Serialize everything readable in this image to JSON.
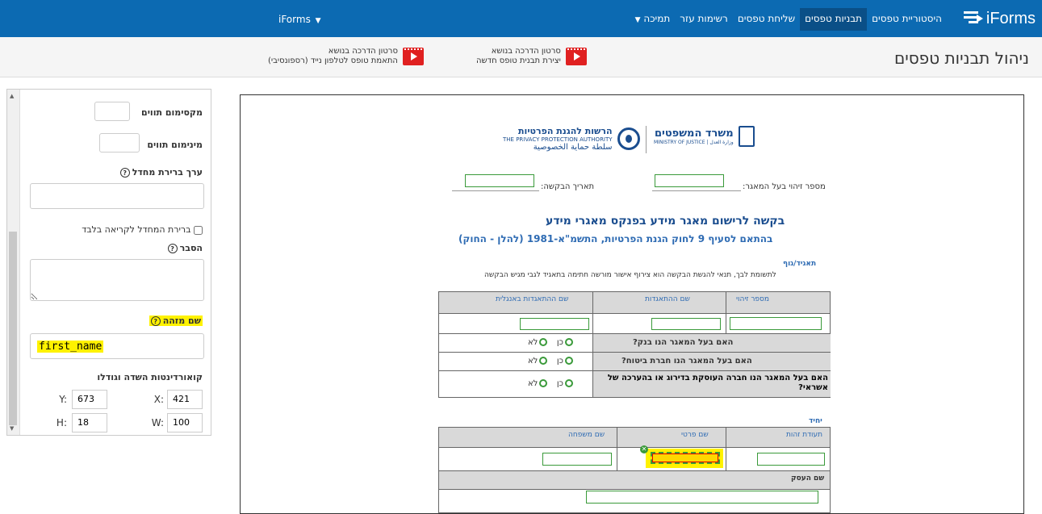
{
  "topbar": {
    "brand": "iForms",
    "nav": [
      "היסטוריית טפסים",
      "תבניות טפסים",
      "שליחת טפסים",
      "רשימות עזר",
      "תמיכה"
    ],
    "active_index": 1,
    "user_menu": "iForms"
  },
  "subheader": {
    "title": "ניהול תבניות טפסים",
    "tutorial1": {
      "line1": "סרטון הדרכה בנושא",
      "line2": "יצירת תבנית טופס חדשה"
    },
    "tutorial2": {
      "line1": "סרטון הדרכה בנושא",
      "line2": "התאמת טופס לטלפון נייד (רספונסיבי)"
    }
  },
  "panel": {
    "max_chars_label": "מקסימום תווים",
    "min_chars_label": "מינימום תווים",
    "default_value_label": "ערך ברירת מחדל",
    "readonly_label": "ברירת המחדל לקריאה בלבד",
    "explanation_label": "הסבר",
    "id_name_label": "שם מזהה",
    "id_name_value": "first_name",
    "coords_label": "קואורדינטות השדה וגודלו",
    "y_label": "Y:",
    "y_value": "673",
    "x_label": "X:",
    "x_value": "421",
    "h_label": "H:",
    "h_value": "18",
    "w_label": "W:",
    "w_value": "100"
  },
  "doc": {
    "ministry": {
      "he": "משרד המשפטים",
      "sub": "MINISTRY OF JUSTICE | وزارة العدل"
    },
    "ppa": {
      "he": "הרשות להגנת הפרטיות",
      "en": "THE PRIVACY PROTECTION AUTHORITY",
      "ar": "سلطة حماية الخصوصية"
    },
    "db_owner_id_label": "מספר זיהוי בעל המאגר:",
    "request_date_label": "תאריך הבקשה:",
    "title": "בקשה לרישום מאגר מידע בפנקס מאגרי מידע",
    "subtitle": "בהתאם לסעיף 9 לחוק הגנת הפרטיות, התשמ\"א-1981 (להלן - החוק)",
    "corp_heading": "תאגיד/גוף",
    "corp_note": "לתשומת לבך, תנאי להגשת הבקשה הוא צירוף אישור מורשה חתימה בתאגיד לגבי מגיש הבקשה",
    "col_id": "מספר זיהוי",
    "col_name": "שם ההתאגדות",
    "col_en_name": "שם ההתאגדות באנגלית",
    "q_bank": "האם בעל המאגר הנו בנק?",
    "q_insurance": "האם בעל המאגר הנו חברת ביטוח?",
    "q_credit": "האם בעל המאגר הנו חברה העוסקת בדירוג או בהערכה של אשראי?",
    "yes": "כן",
    "no": "לא",
    "individual_heading": "יחיד",
    "col_tz": "תעודת זהות",
    "col_first": "שם פרטי",
    "col_last": "שם משפחה",
    "business_name": "שם העסק"
  }
}
